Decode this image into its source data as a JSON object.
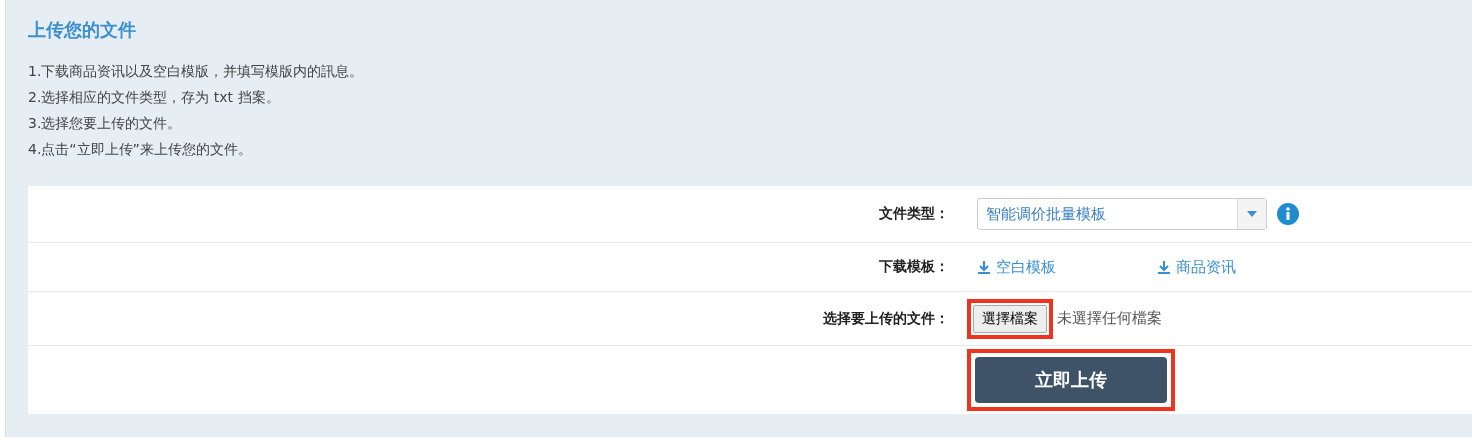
{
  "title": "上传您的文件",
  "instructions": [
    "1.下载商品资讯以及空白模版，并填写模版内的訊息。",
    "2.选择相应的文件类型，存为 txt 挡案。",
    "3.选择您要上传的文件。",
    "4.点击“立即上传”来上传您的文件。"
  ],
  "file_type": {
    "label": "文件类型：",
    "value": "智能调价批量模板"
  },
  "download": {
    "label": "下载模板：",
    "links": [
      "空白模板",
      "商品资讯"
    ]
  },
  "upload": {
    "label": "选择要上传的文件：",
    "button": "選擇檔案",
    "status": "未選擇任何檔案",
    "highlighted": true
  },
  "submit": {
    "label": "立即上传",
    "highlighted": true
  }
}
